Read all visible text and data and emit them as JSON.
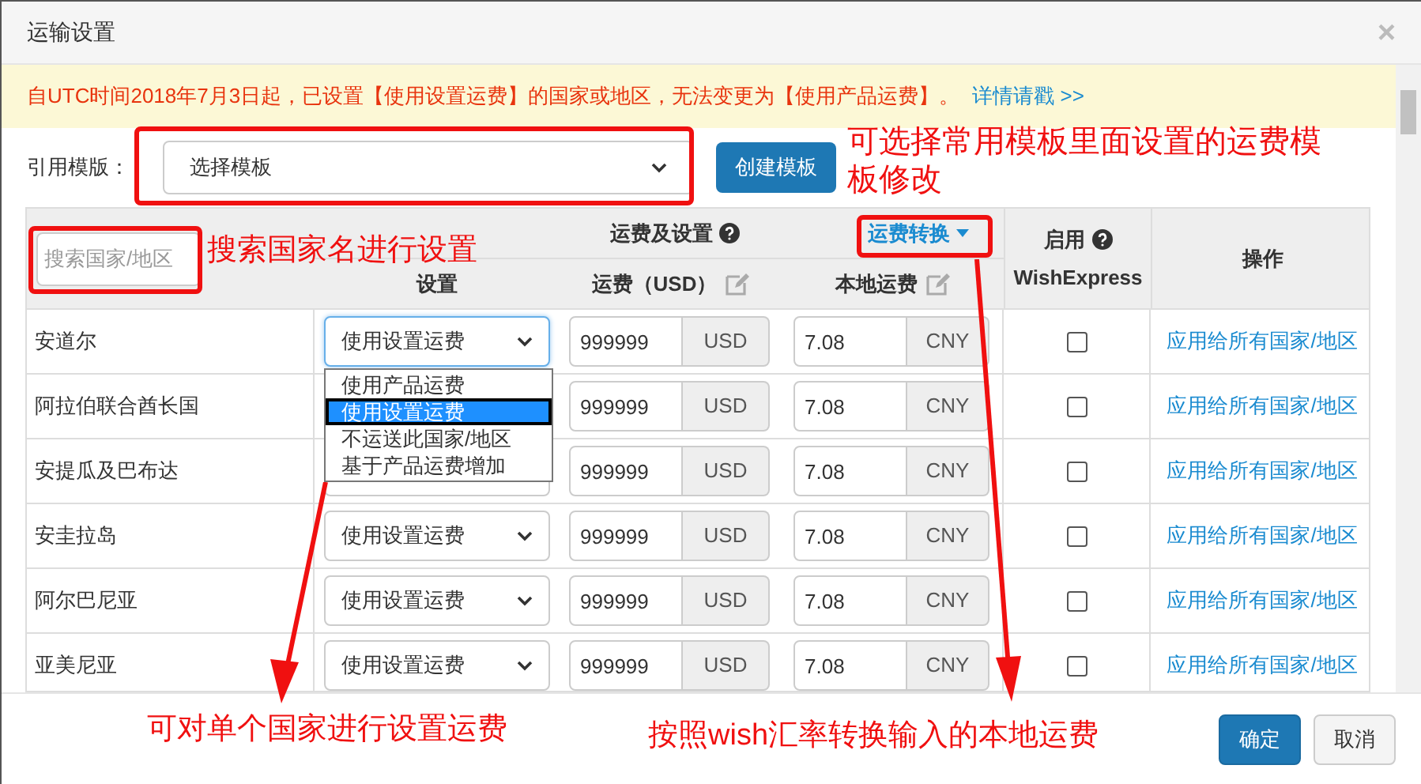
{
  "window": {
    "title": "运输设置",
    "close": "×"
  },
  "notice": {
    "text": "自UTC时间2018年7月3日起，已设置【使用设置运费】的国家或地区，无法变更为【使用产品运费】。",
    "link": "详情请戳 >>"
  },
  "template": {
    "label": "引用模版：",
    "value": "选择模板",
    "create_button": "创建模板"
  },
  "table": {
    "search_placeholder": "搜索国家/地区",
    "group_heading": "运费及设置",
    "convert_link": "运费转换",
    "enable_heading": "启用",
    "enable_subheading": "WishExpress",
    "action_heading": "操作",
    "setting_heading": "设置",
    "usd_heading": "运费（USD）",
    "local_heading": "本地运费",
    "rows": [
      {
        "country": "安道尔",
        "setting": "使用设置运费",
        "usd": "999999",
        "usd_unit": "USD",
        "local": "7.08",
        "local_unit": "CNY",
        "wish_express": false,
        "action": "应用给所有国家/地区",
        "focused": true
      },
      {
        "country": "阿拉伯联合酋长国",
        "usd": "999999",
        "usd_unit": "USD",
        "local": "7.08",
        "local_unit": "CNY",
        "wish_express": false,
        "action": "应用给所有国家/地区",
        "focused": false
      },
      {
        "country": "安提瓜及巴布达",
        "usd": "999999",
        "usd_unit": "USD",
        "local": "7.08",
        "local_unit": "CNY",
        "wish_express": false,
        "action": "应用给所有国家/地区",
        "focused": false
      },
      {
        "country": "安圭拉岛",
        "setting": "使用设置运费",
        "usd": "999999",
        "usd_unit": "USD",
        "local": "7.08",
        "local_unit": "CNY",
        "wish_express": false,
        "action": "应用给所有国家/地区",
        "focused": false
      },
      {
        "country": "阿尔巴尼亚",
        "setting": "使用设置运费",
        "usd": "999999",
        "usd_unit": "USD",
        "local": "7.08",
        "local_unit": "CNY",
        "wish_express": false,
        "action": "应用给所有国家/地区",
        "focused": false
      },
      {
        "country": "亚美尼亚",
        "setting": "使用设置运费",
        "usd": "999999",
        "usd_unit": "USD",
        "local": "7.08",
        "local_unit": "CNY",
        "wish_express": false,
        "action": "应用给所有国家/地区",
        "focused": false
      }
    ],
    "dropdown_options": [
      {
        "label": "使用产品运费",
        "selected": false
      },
      {
        "label": "使用设置运费",
        "selected": true
      },
      {
        "label": "不运送此国家/地区",
        "selected": false
      },
      {
        "label": "基于产品运费增加",
        "selected": false
      }
    ]
  },
  "footer": {
    "buttons": [
      {
        "label": "确定",
        "kind": "primary"
      },
      {
        "label": "取消",
        "kind": "default"
      }
    ]
  },
  "annotations": [
    {
      "text": "可选择常用模板里面设置的运费模板修改"
    },
    {
      "text": "搜索国家名进行设置"
    },
    {
      "text": "可对单个国家进行设置运费"
    },
    {
      "text": "按照wish汇率转换输入的本地运费"
    }
  ]
}
